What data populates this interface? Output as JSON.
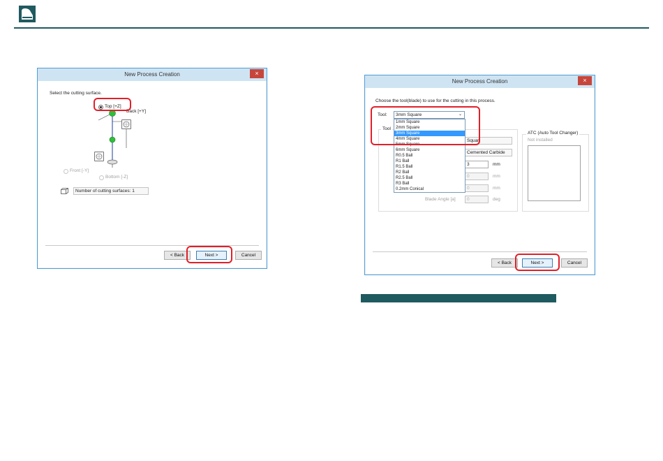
{
  "left_dialog": {
    "title": "New Process Creation",
    "close_glyph": "×",
    "prompt": "Select the cutting surface.",
    "surfaces": {
      "top": "Top [+Z]",
      "back": "Back [+Y]",
      "front": "Front [-Y]",
      "bottom": "Bottom [-Z]"
    },
    "count_label": "Number of cutting surfaces: 1",
    "buttons": {
      "back": "< Back",
      "next": "Next >",
      "cancel": "Cancel"
    }
  },
  "right_dialog": {
    "title": "New Process Creation",
    "close_glyph": "×",
    "prompt": "Choose the tool(blade) to use for the cutting in this process.",
    "tool_label": "Tool:",
    "tool_selected": "3mm Square",
    "tool_options": [
      "1mm Square",
      "2mm Square",
      "3mm Square",
      "4mm Square",
      "5mm Square",
      "6mm Square",
      "R0.5 Ball",
      "R1 Ball",
      "R1.5 Ball",
      "R2 Ball",
      "R2.5 Ball",
      "R3 Ball",
      "0.2mm Conical"
    ],
    "group_label": "Tool",
    "fields": {
      "shape": "Squar",
      "material": "Cemented Carbide",
      "diameter": "3",
      "diameter_unit": "mm",
      "f2": "0",
      "f2_unit": "mm",
      "f3": "0",
      "f3_unit": "mm",
      "blade_angle_label": "Blade Angle [a]",
      "blade_angle": "0",
      "blade_angle_unit": "deg"
    },
    "atc_label": "ATC (Auto Tool Changer)",
    "atc_status": "Not installed",
    "buttons": {
      "back": "< Back",
      "next": "Next >",
      "cancel": "Cancel"
    }
  },
  "colors": {
    "brand": "#1f5a60",
    "highlight": "#e0202a",
    "window_border": "#4f9dd6",
    "close": "#c7463c"
  }
}
